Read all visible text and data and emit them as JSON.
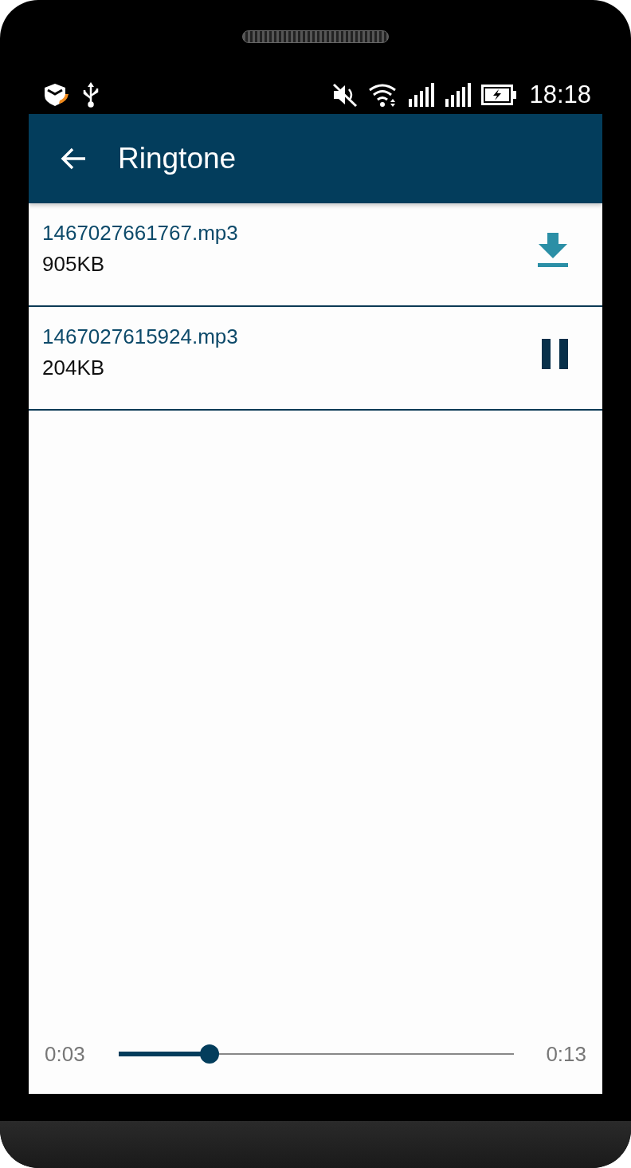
{
  "status_bar": {
    "time": "18:18"
  },
  "app_bar": {
    "title": "Ringtone"
  },
  "files": [
    {
      "name": "1467027661767.mp3",
      "size": "905KB",
      "kind": "download"
    },
    {
      "name": "1467027615924.mp3",
      "size": "204KB",
      "kind": "pause"
    }
  ],
  "player": {
    "elapsed": "0:03",
    "total": "0:13",
    "level": 0.23
  }
}
